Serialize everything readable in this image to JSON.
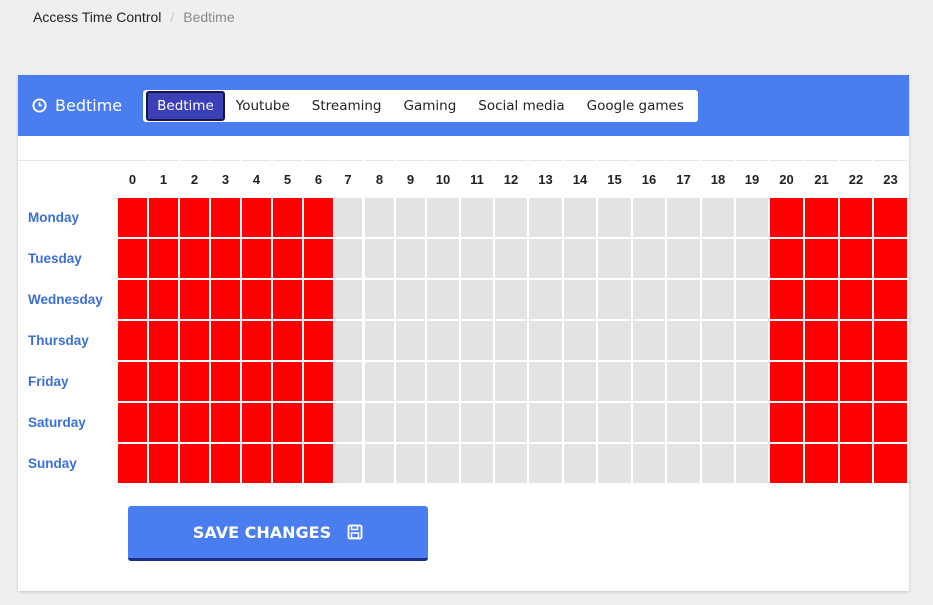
{
  "breadcrumb": {
    "parent": "Access Time Control",
    "separator": "/",
    "current": "Bedtime"
  },
  "panel": {
    "title": "Bedtime",
    "icon": "clock-icon"
  },
  "tabs": [
    {
      "label": "Bedtime",
      "active": true
    },
    {
      "label": "Youtube",
      "active": false
    },
    {
      "label": "Streaming",
      "active": false
    },
    {
      "label": "Gaming",
      "active": false
    },
    {
      "label": "Social media",
      "active": false
    },
    {
      "label": "Google games",
      "active": false
    }
  ],
  "schedule": {
    "hours": [
      "0",
      "1",
      "2",
      "3",
      "4",
      "5",
      "6",
      "7",
      "8",
      "9",
      "10",
      "11",
      "12",
      "13",
      "14",
      "15",
      "16",
      "17",
      "18",
      "19",
      "20",
      "21",
      "22",
      "23"
    ],
    "days": [
      "Monday",
      "Tuesday",
      "Wednesday",
      "Thursday",
      "Friday",
      "Saturday",
      "Sunday"
    ],
    "blocked_hours": [
      0,
      1,
      2,
      3,
      4,
      5,
      6,
      20,
      21,
      22,
      23
    ],
    "colors": {
      "blocked": "#ff0000",
      "allowed": "#e3e3e3",
      "accent": "#4a7ef0",
      "day_label": "#3c6fd6"
    }
  },
  "actions": {
    "save_label": "SAVE CHANGES",
    "save_icon": "floppy-disk-icon"
  }
}
